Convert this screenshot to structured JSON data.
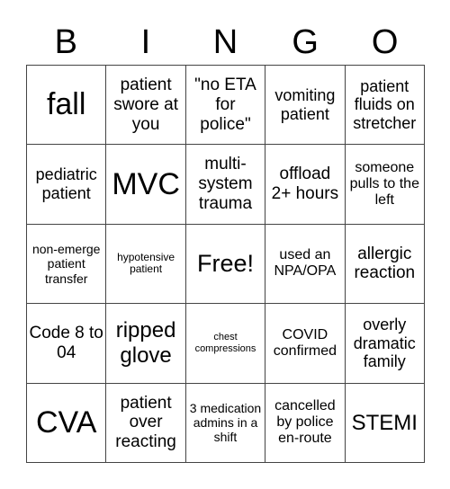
{
  "header": {
    "letters": [
      "B",
      "I",
      "N",
      "G",
      "O"
    ]
  },
  "board": {
    "cells": [
      [
        "fall",
        "patient swore at you",
        "\"no ETA for police\"",
        "vomiting patient",
        "patient fluids on stretcher"
      ],
      [
        "pediatric patient",
        "MVC",
        "multi-system trauma",
        "offload 2+ hours",
        "someone pulls to the left"
      ],
      [
        "non-emerge patient transfer",
        "hypotensive patient",
        "Free!",
        "used an NPA/OPA",
        "allergic reaction"
      ],
      [
        "Code 8 to 04",
        "ripped glove",
        "chest compressions",
        "COVID confirmed",
        "overly dramatic family"
      ],
      [
        "CVA",
        "patient over reacting",
        "3 medication admins in a shift",
        "cancelled by police en-route",
        "STEMI"
      ]
    ]
  }
}
